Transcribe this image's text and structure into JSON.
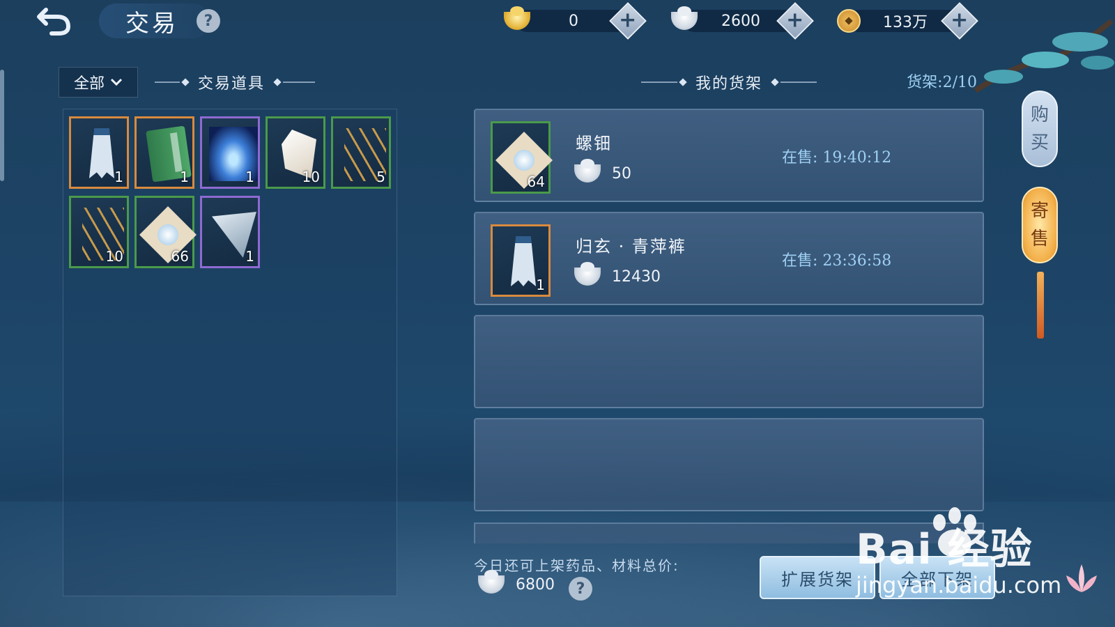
{
  "header": {
    "title": "交易",
    "back_icon": "back-arrow-icon",
    "help_label": "?"
  },
  "currencies": [
    {
      "name": "gold-ingot",
      "value": "0",
      "plus_label": "+"
    },
    {
      "name": "silver-ingot",
      "value": "2600",
      "plus_label": "+"
    },
    {
      "name": "copper-coin",
      "value": "133万",
      "plus_label": "+"
    }
  ],
  "inventory": {
    "filter_label": "全部",
    "section_title": "交易道具",
    "items": [
      {
        "art": "skirt",
        "qty": "1",
        "rarity": "orange"
      },
      {
        "art": "book",
        "qty": "1",
        "rarity": "orange"
      },
      {
        "art": "swirl",
        "qty": "1",
        "rarity": "purple"
      },
      {
        "art": "cloth",
        "qty": "10",
        "rarity": "green"
      },
      {
        "art": "sticks",
        "qty": "5",
        "rarity": "green"
      },
      {
        "art": "sticks",
        "qty": "10",
        "rarity": "green"
      },
      {
        "art": "pearl",
        "qty": "66",
        "rarity": "green"
      },
      {
        "art": "scarf",
        "qty": "1",
        "rarity": "purple"
      }
    ]
  },
  "shelf": {
    "section_title": "我的货架",
    "count_label": "货架:2/10",
    "listings": [
      {
        "name": "螺钿",
        "qty": "64",
        "price": "50",
        "status": "在售: 19:40:12",
        "art": "pearl",
        "rarity": "green"
      },
      {
        "name": "归玄 · 青萍裤",
        "qty": "1",
        "price": "12430",
        "status": "在售: 23:36:58",
        "art": "skirt",
        "rarity": "orange"
      }
    ]
  },
  "footer": {
    "quota_label": "今日还可上架药品、材料总价:",
    "quota_value": "6800",
    "help_label": "?",
    "expand_button": "扩展货架",
    "delist_button": "全部下架"
  },
  "side_tabs": {
    "buy_1": "购",
    "buy_2": "买",
    "sell_1": "寄",
    "sell_2": "售"
  },
  "watermark": {
    "main": "Bai 经验",
    "sub": "jingyan.baidu.com"
  }
}
